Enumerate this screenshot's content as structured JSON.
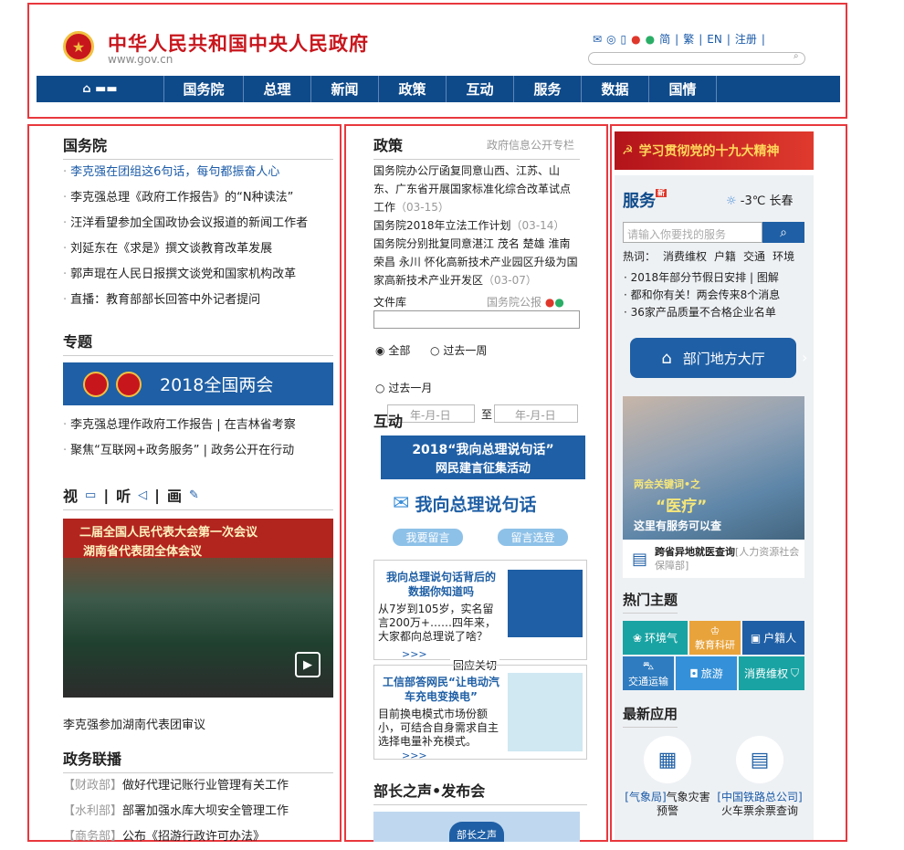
{
  "header": {
    "title": "中华人民共和国中央人民政府",
    "url": "www.gov.cn",
    "links": [
      "简",
      "繁",
      "EN",
      "注册"
    ],
    "icons": [
      "mail-icon",
      "chat-icon",
      "mobile-icon",
      "weibo-icon",
      "wechat-icon"
    ]
  },
  "nav": {
    "items": [
      "国务院",
      "总理",
      "新闻",
      "政策",
      "互动",
      "服务",
      "数据",
      "国情"
    ]
  },
  "left": {
    "state_council": {
      "title": "国务院",
      "items": [
        "李克强在团组这6句话，每句都振奋人心",
        "李克强总理《政府工作报告》的“N种读法”",
        "汪洋看望参加全国政协会议报道的新闻工作者",
        "刘延东在《求是》撰文谈教育改革发展",
        "郭声琨在人民日报撰文谈党和国家机构改革",
        "直播：教育部部长回答中外记者提问"
      ]
    },
    "topics": {
      "title": "专题",
      "banner": "2018全国两会",
      "items": [
        "李克强总理作政府工作报告 | 在吉林省考察",
        "聚焦“互联网+政务服务” | 政务公开在行动"
      ]
    },
    "media": {
      "tabs": [
        "视",
        "听",
        "画"
      ],
      "photo_text_1": "二届全国人民代表大会第一次会议",
      "photo_text_2": "湖南省代表团全体会议",
      "caption": "李克强参加湖南代表团审议"
    },
    "gov_links": {
      "title": "政务联播",
      "items": [
        {
          "dept": "【财政部】",
          "text": "做好代理记账行业管理有关工作"
        },
        {
          "dept": "【水利部】",
          "text": "部署加强水库大坝安全管理工作"
        },
        {
          "dept": "【商务部】",
          "text": "公布《招游行政许可办法》"
        }
      ]
    }
  },
  "middle": {
    "policy": {
      "title": "政策",
      "subtitle": "政府信息公开专栏",
      "items": [
        {
          "text": "国务院办公厅函复同意山西、江苏、山东、广东省开展国家标准化综合改革试点工作",
          "date": "（03-15）"
        },
        {
          "text": "国务院2018年立法工作计划",
          "date": "（03-14）"
        },
        {
          "text": "国务院分别批复同意湛江 茂名 楚雄 淮南 荣昌 永川 怀化高新技术产业园区升级为国家高新技术产业开发区",
          "date": "（03-07）"
        }
      ]
    },
    "docs": {
      "label": "文件库",
      "gazette": "国务院公报",
      "radio_all": "全部",
      "radio_week": "过去一周",
      "radio_month": "过去一月",
      "date_placeholder": "年-月-日",
      "to": "至"
    },
    "interact": {
      "title": "互动",
      "banner_line1": "2018“我向总理说句话”",
      "banner_line2": "网民建言征集活动",
      "slogan": "我向总理说句话",
      "btn1": "我要留言",
      "btn2": "留言选登",
      "card1_title": "我向总理说句话背后的数据你知道吗",
      "card1_body": "从7岁到105岁，实名留言200万+……四年来，大家都向总理说了啥？",
      "card1_more": ">>>",
      "card1_badge": "回应关切",
      "card2_title": "工信部答网民“让电动汽车充电变换电”",
      "card2_body": "目前换电模式市场份额小，可结合自身需求自主选择电量补充模式。",
      "card2_more": ">>>"
    },
    "minister": {
      "title": "部长之声•发布会",
      "badge": "部长之声"
    }
  },
  "right": {
    "banner": "学习贯彻党的十九大精神",
    "service": {
      "title": "服务",
      "weather": "-3℃ 长春",
      "search_placeholder": "请输入你要找的服务",
      "hot_label": "热词：",
      "hot_words": [
        "消费维权",
        "户籍",
        "交通",
        "环境"
      ],
      "items": [
        "2018年部分节假日安排 | 图解",
        "都和你有关！两会传来8个消息",
        "36家产品质量不合格企业名单"
      ],
      "dept_hall": "部门地方大厅"
    },
    "photo": {
      "text1": "两会关键词•之",
      "text2": "“医疗”",
      "text3": "这里有服务可以查"
    },
    "cross_query": {
      "title": "跨省异地就医查询",
      "source": "[人力资源社会保障部]"
    },
    "hot_topics": {
      "title": "热门主题",
      "tiles": [
        "环境气",
        "教育科研",
        "户籍人",
        "交通运输",
        "旅游",
        "消费维权"
      ]
    },
    "apps": {
      "title": "最新应用",
      "items": [
        {
          "org": "[气象局]",
          "name": "气象灾害预警"
        },
        {
          "org": "[中国铁路总公司]",
          "name": "火车票余票查询"
        }
      ]
    }
  }
}
